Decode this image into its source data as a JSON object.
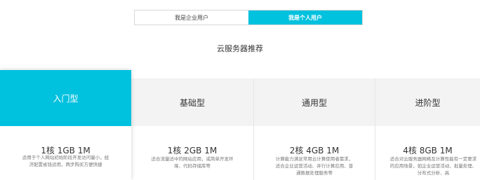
{
  "tabs": [
    {
      "label": "我是企业用户",
      "active": false
    },
    {
      "label": "我是个人用户",
      "active": true
    }
  ],
  "section_title": "云服务器推荐",
  "colors": {
    "accent": "#00c1de",
    "card_head": "#f3f3f3"
  },
  "cards": [
    {
      "name": "入门型",
      "spec": "1核 1GB 1M",
      "desc": "适用于个人网站初始阶段开发访问量小，经济配置省钱适用，两步购买方便快捷"
    },
    {
      "name": "基础型",
      "spec": "1核 2GB 1M",
      "desc": "适合流量适中的网站应用，或简单开发环境、代码存储库等"
    },
    {
      "name": "通用型",
      "spec": "2核 4GB 1M",
      "desc": "计算能力满足常用云计算使用者需求，适合企业运营活动、并行计算应用、普通数据处理服务等"
    },
    {
      "name": "进阶型",
      "spec": "4核 8GB 1M",
      "desc": "适合对云服务器网络及计算性能有一定要求的应用场景，如企业运营活动、批量处理、分布式分析、高"
    }
  ]
}
